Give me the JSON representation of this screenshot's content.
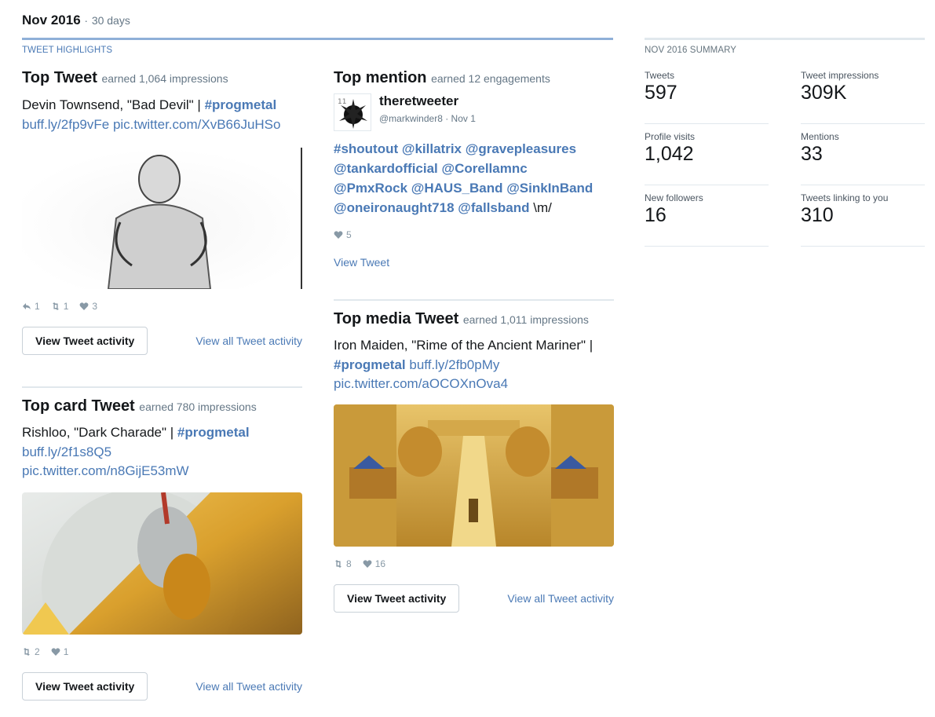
{
  "header": {
    "period": "Nov 2016",
    "separator": "·",
    "days": "30 days"
  },
  "highlights_label": "TWEET HIGHLIGHTS",
  "summary": {
    "label": "NOV 2016 SUMMARY",
    "metrics": [
      {
        "label": "Tweets",
        "value": "597"
      },
      {
        "label": "Tweet impressions",
        "value": "309K"
      },
      {
        "label": "Profile visits",
        "value": "1,042"
      },
      {
        "label": "Mentions",
        "value": "33"
      },
      {
        "label": "New followers",
        "value": "16"
      },
      {
        "label": "Tweets linking to you",
        "value": "310"
      }
    ]
  },
  "top_tweet": {
    "title": "Top Tweet",
    "subtitle": "earned 1,064 impressions",
    "text_plain": "Devin Townsend, \"Bad Devil\" | ",
    "hashtag": "#progmetal",
    "link1": "buff.ly/2fp9vFe",
    "link2": "pic.twitter.com/XvB66JuHSo",
    "stats": {
      "replies": "1",
      "retweets": "1",
      "likes": "3"
    },
    "button": "View Tweet activity",
    "view_all": "View all Tweet activity"
  },
  "top_mention": {
    "title": "Top mention",
    "subtitle": "earned 12 engagements",
    "user_name": "theretweeter",
    "handle": "@markwinder8",
    "date": "· Nov 1",
    "tags": [
      "#shoutout",
      "@killatrix",
      "@gravepleasures",
      "@tankardofficial",
      "@Corellamnc",
      "@PmxRock",
      "@HAUS_Band",
      "@SinkInBand",
      "@oneironaught718",
      "@fallsband"
    ],
    "suffix": "\\m/",
    "likes": "5",
    "view_tweet": "View Tweet"
  },
  "top_card": {
    "title": "Top card Tweet",
    "subtitle": "earned 780 impressions",
    "text_plain": "Rishloo, \"Dark Charade\" | ",
    "hashtag": "#progmetal",
    "link1": "buff.ly/2f1s8Q5",
    "link2": "pic.twitter.com/n8GijE53mW",
    "stats": {
      "retweets": "2",
      "likes": "1"
    },
    "button": "View Tweet activity",
    "view_all": "View all Tweet activity"
  },
  "top_media": {
    "title": "Top media Tweet",
    "subtitle": "earned 1,011 impressions",
    "text_plain": "Iron Maiden, \"Rime of the Ancient Mariner\" |",
    "hashtag": "#progmetal",
    "link1": "buff.ly/2fb0pMy",
    "link2": "pic.twitter.com/aOCOXnOva4",
    "stats": {
      "retweets": "8",
      "likes": "16"
    },
    "button": "View Tweet activity",
    "view_all": "View all Tweet activity"
  },
  "colors": {
    "link": "#4a79b5",
    "accent_rule": "#8fb0d8",
    "muted": "#657786",
    "border": "#e1e8ed"
  },
  "icons": {
    "reply": "reply-icon",
    "retweet": "retweet-icon",
    "like": "heart-icon"
  }
}
